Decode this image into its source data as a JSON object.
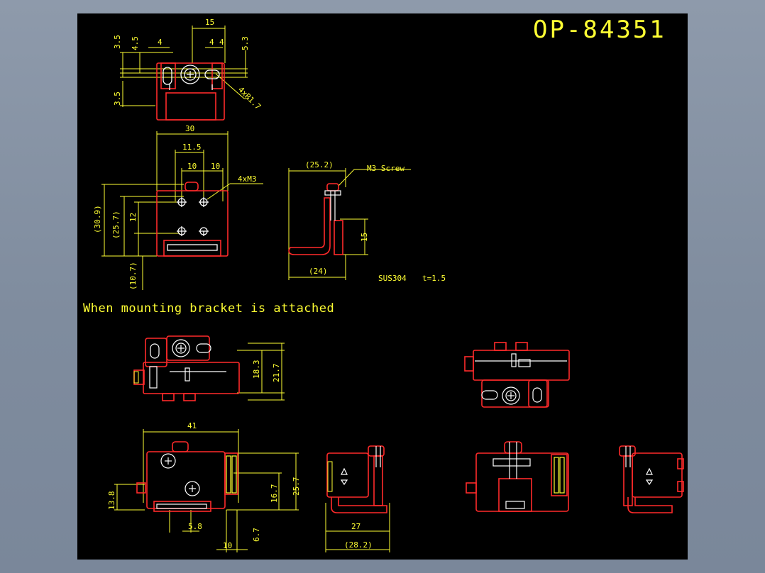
{
  "drawing": {
    "part_number": "OP-84351",
    "caption": "When mounting bracket is attached",
    "material": "SUS304",
    "thickness": "t=1.5",
    "callouts": {
      "screw": "M3 Screw",
      "holes": "4xM3",
      "radius": "4xR1.7"
    },
    "top_view_dims": {
      "d15": "15",
      "d3_5a": "3.5",
      "d4_5": "4.5",
      "d4a": "4",
      "d4b": "4",
      "d4c": "4",
      "d5_3": "5.3",
      "d3_5b": "3.5"
    },
    "front_view_dims": {
      "d30": "30",
      "d11_5": "11.5",
      "d10a": "10",
      "d10b": "10",
      "d30_9": "(30.9)",
      "d25_7": "(25.7)",
      "d12": "12",
      "d10_7": "(10.7)"
    },
    "bracket_dims": {
      "d25_2": "(25.2)",
      "d15": "15",
      "d24": "(24)"
    },
    "assembly_dims": {
      "d18_3": "18.3",
      "d21_7": "21.7",
      "d41": "41",
      "d25_7": "25.7",
      "d16_7": "16.7",
      "d13_8": "13.8",
      "d5_8": "5.8",
      "d6_7": "6.7",
      "d10": "10",
      "d27": "27",
      "d28_2": "(28.2)"
    }
  },
  "colors": {
    "background_outer": "#8493a6",
    "drawing_bg": "#000000",
    "outline": "#ff2a2a",
    "feature": "#ffffff",
    "dimension": "#ffff33",
    "hidden": "#cccc00"
  }
}
